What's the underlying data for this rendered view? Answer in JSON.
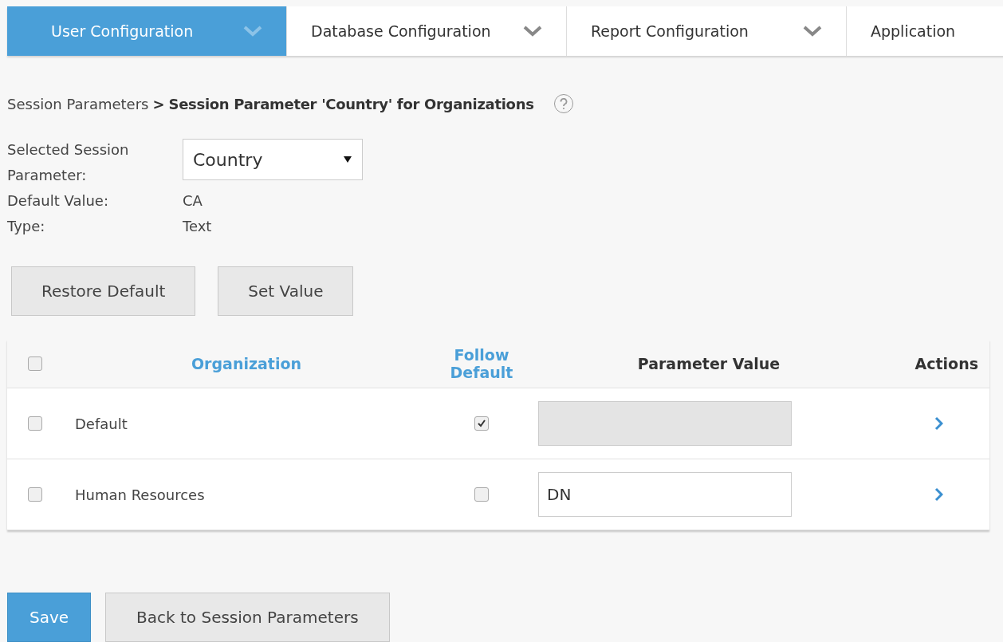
{
  "tabs": [
    {
      "label": "User Configuration",
      "selected": true
    },
    {
      "label": "Database Configuration",
      "selected": false
    },
    {
      "label": "Report Configuration",
      "selected": false
    },
    {
      "label": "Application",
      "selected": false
    }
  ],
  "breadcrumb": {
    "parent": "Session Parameters",
    "separator": ">",
    "current": "Session Parameter 'Country' for Organizations"
  },
  "details": {
    "selected_label": "Selected Session Parameter:",
    "selected_value": "Country",
    "default_label": "Default Value:",
    "default_value": "CA",
    "type_label": "Type:",
    "type_value": "Text"
  },
  "actions": [
    "Restore Default",
    "Set Value"
  ],
  "table": {
    "select_all_checked": false,
    "columns": [
      {
        "label": "Organization",
        "sortable": true
      },
      {
        "label": "Follow Default",
        "sortable": true
      },
      {
        "label": "Parameter Value",
        "sortable": false
      },
      {
        "label": "Actions",
        "sortable": false
      }
    ],
    "rows": [
      {
        "checked": false,
        "organization": "Default",
        "follow_default": true
      },
      {
        "checked": false,
        "organization": "Human Resources",
        "follow_default": false,
        "value": "DN"
      }
    ]
  },
  "footer_buttons": [
    {
      "label": "Save",
      "kind": "primary"
    },
    {
      "label": "Back to Session Parameters",
      "kind": "secondary"
    }
  ]
}
